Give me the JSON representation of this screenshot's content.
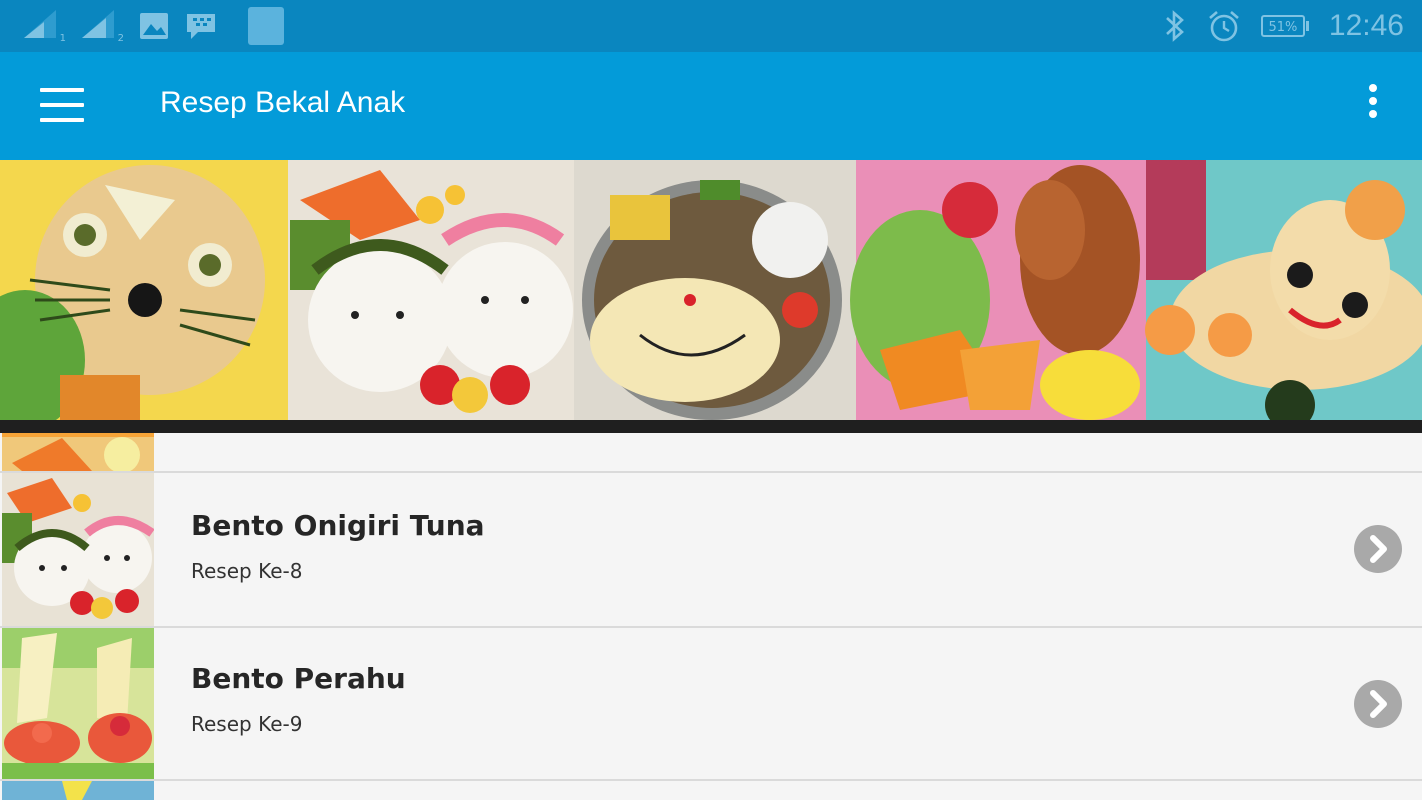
{
  "status_bar": {
    "sim1_label": "1",
    "sim2_label": "2",
    "battery": "51%",
    "time": "12:46",
    "icons": [
      "signal-icon",
      "signal-icon",
      "image-icon",
      "bbm-icon",
      "notification-icon",
      "bluetooth-icon",
      "alarm-icon",
      "battery-icon"
    ]
  },
  "app_bar": {
    "title": "Resep Bekal Anak",
    "menu_icon": "hamburger-menu-icon",
    "more_icon": "more-vert-icon"
  },
  "colors": {
    "status_bar": "#0a86bf",
    "app_bar": "#039bd9",
    "list_background": "#f5f5f5",
    "chevron_circle": "#a9a9a9"
  },
  "recipes": [
    {
      "title": "Bento Onigiri Tuna",
      "subtitle": "Resep Ke-8"
    },
    {
      "title": "Bento Perahu",
      "subtitle": "Resep Ke-9"
    }
  ]
}
